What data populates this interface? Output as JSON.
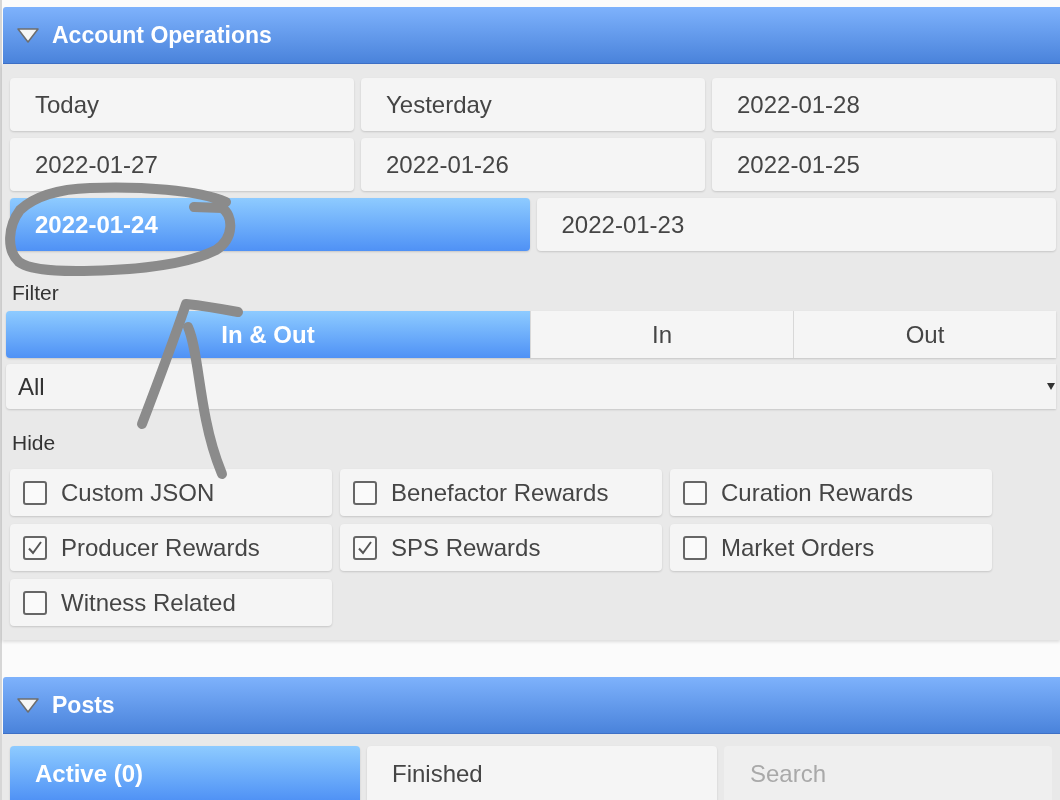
{
  "account_operations": {
    "title": "Account Operations",
    "expanded": true,
    "date_buttons": [
      {
        "label": "Today",
        "selected": false
      },
      {
        "label": "Yesterday",
        "selected": false
      },
      {
        "label": "2022-01-28",
        "selected": false
      },
      {
        "label": "2022-01-27",
        "selected": false
      },
      {
        "label": "2022-01-26",
        "selected": false
      },
      {
        "label": "2022-01-25",
        "selected": false
      },
      {
        "label": "2022-01-24",
        "selected": true
      },
      {
        "label": "2022-01-23",
        "selected": false
      }
    ],
    "filter": {
      "label": "Filter",
      "options": [
        {
          "label": "In & Out",
          "selected": true
        },
        {
          "label": "In",
          "selected": false
        },
        {
          "label": "Out",
          "selected": false
        }
      ],
      "select": {
        "value": "All"
      }
    },
    "hide": {
      "label": "Hide",
      "checkboxes": [
        {
          "label": "Custom JSON",
          "checked": false
        },
        {
          "label": "Benefactor Rewards",
          "checked": false
        },
        {
          "label": "Curation Rewards",
          "checked": false
        },
        {
          "label": "Producer Rewards",
          "checked": true
        },
        {
          "label": "SPS Rewards",
          "checked": true
        },
        {
          "label": "Market Orders",
          "checked": false
        },
        {
          "label": "Witness Related",
          "checked": false
        }
      ]
    }
  },
  "posts": {
    "title": "Posts",
    "expanded": true,
    "tabs": [
      {
        "label": "Active (0)",
        "selected": true
      },
      {
        "label": "Finished",
        "selected": false
      }
    ],
    "search": {
      "placeholder": "Search"
    }
  }
}
